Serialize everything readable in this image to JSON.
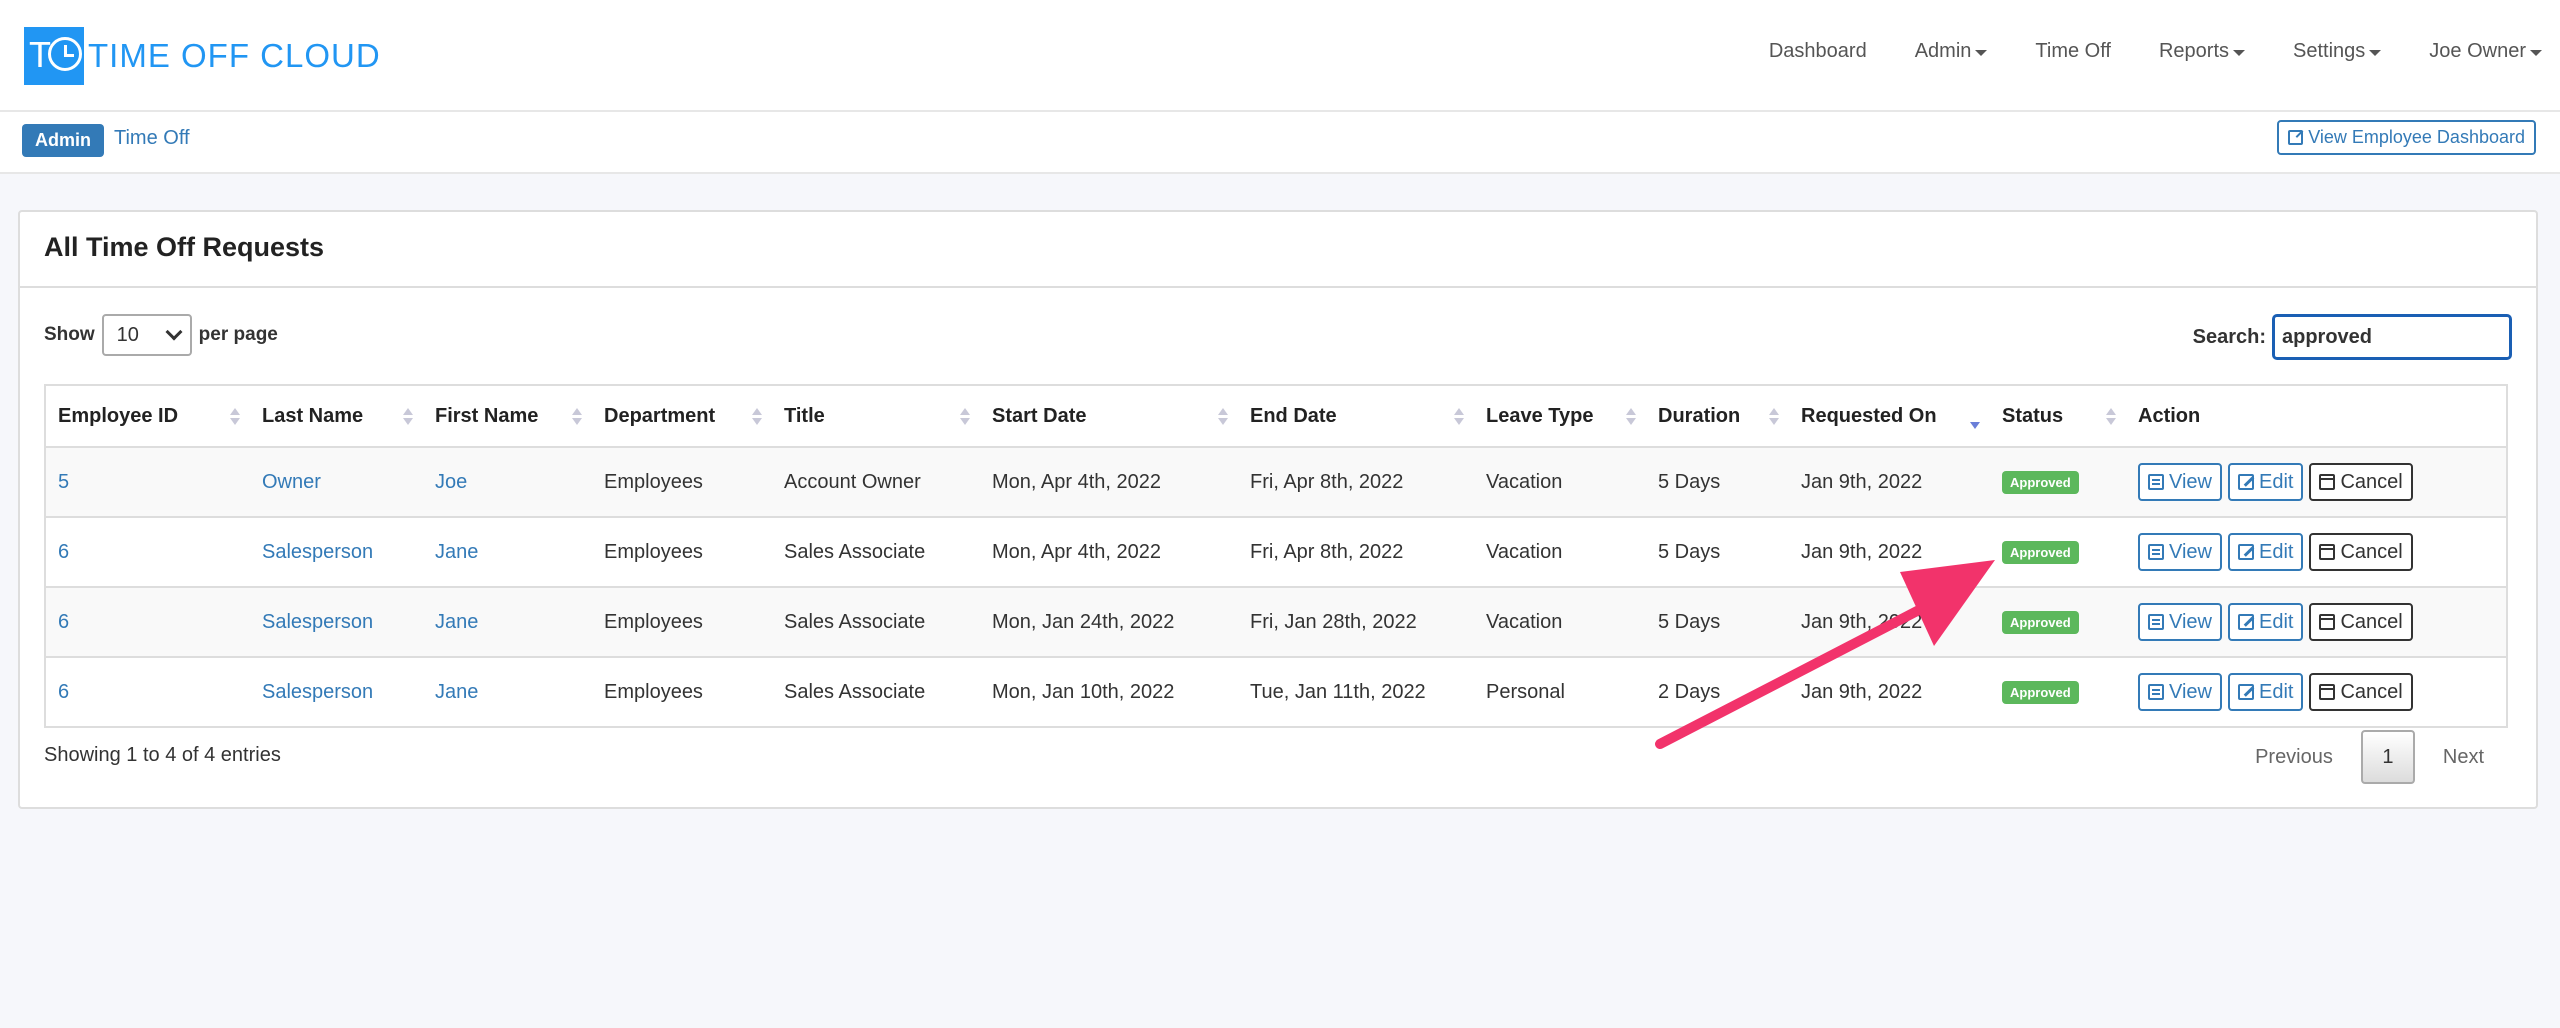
{
  "brand": {
    "logo_letters": "TO",
    "name": "TIME OFF CLOUD",
    "color": "#2196f3"
  },
  "nav": {
    "items": [
      {
        "label": "Dashboard",
        "dropdown": false
      },
      {
        "label": "Admin",
        "dropdown": true
      },
      {
        "label": "Time Off",
        "dropdown": false
      },
      {
        "label": "Reports",
        "dropdown": true
      },
      {
        "label": "Settings",
        "dropdown": true
      },
      {
        "label": "Joe Owner",
        "dropdown": true
      }
    ]
  },
  "breadcrumb": {
    "admin": "Admin",
    "current": "Time Off"
  },
  "view_dashboard_button": "View Employee Dashboard",
  "panel": {
    "title": "All Time Off Requests"
  },
  "length": {
    "show_label": "Show",
    "value": "10",
    "suffix": "per page"
  },
  "search": {
    "label": "Search:",
    "value": "approved"
  },
  "table": {
    "columns": [
      "Employee ID",
      "Last Name",
      "First Name",
      "Department",
      "Title",
      "Start Date",
      "End Date",
      "Leave Type",
      "Duration",
      "Requested On",
      "Status",
      "Action"
    ],
    "rows": [
      {
        "id": "5",
        "last": "Owner",
        "first": "Joe",
        "dept": "Employees",
        "title": "Account Owner",
        "start": "Mon, Apr 4th, 2022",
        "end": "Fri, Apr 8th, 2022",
        "type": "Vacation",
        "duration": "5 Days",
        "requested": "Jan 9th, 2022",
        "status": "Approved"
      },
      {
        "id": "6",
        "last": "Salesperson",
        "first": "Jane",
        "dept": "Employees",
        "title": "Sales Associate",
        "start": "Mon, Apr 4th, 2022",
        "end": "Fri, Apr 8th, 2022",
        "type": "Vacation",
        "duration": "5 Days",
        "requested": "Jan 9th, 2022",
        "status": "Approved"
      },
      {
        "id": "6",
        "last": "Salesperson",
        "first": "Jane",
        "dept": "Employees",
        "title": "Sales Associate",
        "start": "Mon, Jan 24th, 2022",
        "end": "Fri, Jan 28th, 2022",
        "type": "Vacation",
        "duration": "5 Days",
        "requested": "Jan 9th, 2022",
        "status": "Approved"
      },
      {
        "id": "6",
        "last": "Salesperson",
        "first": "Jane",
        "dept": "Employees",
        "title": "Sales Associate",
        "start": "Mon, Jan 10th, 2022",
        "end": "Tue, Jan 11th, 2022",
        "type": "Personal",
        "duration": "2 Days",
        "requested": "Jan 9th, 2022",
        "status": "Approved"
      }
    ],
    "actions": {
      "view": "View",
      "edit": "Edit",
      "cancel": "Cancel"
    }
  },
  "info": "Showing 1 to 4 of 4 entries",
  "pagination": {
    "previous": "Previous",
    "current": "1",
    "next": "Next"
  },
  "colors": {
    "link": "#337ab7",
    "approved": "#5cb85c",
    "arrow": "#f2336b"
  }
}
